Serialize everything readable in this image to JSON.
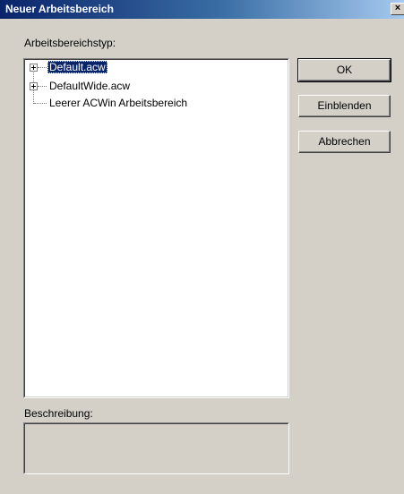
{
  "window": {
    "title": "Neuer Arbeitsbereich",
    "close_glyph": "×"
  },
  "tree": {
    "label": "Arbeitsbereichstyp:",
    "items": [
      {
        "label": "Default.acw",
        "selected": true,
        "expandable": true
      },
      {
        "label": "DefaultWide.acw",
        "selected": false,
        "expandable": true
      },
      {
        "label": "Leerer ACWin Arbeitsbereich",
        "selected": false,
        "expandable": false
      }
    ]
  },
  "description": {
    "label": "Beschreibung:",
    "value": ""
  },
  "buttons": {
    "ok": "OK",
    "show": "Einblenden",
    "cancel": "Abbrechen"
  },
  "colors": {
    "titlebar_start": "#0a246a",
    "titlebar_end": "#a6caf0",
    "dialog_bg": "#d4d0c8",
    "selection": "#0a246a"
  }
}
